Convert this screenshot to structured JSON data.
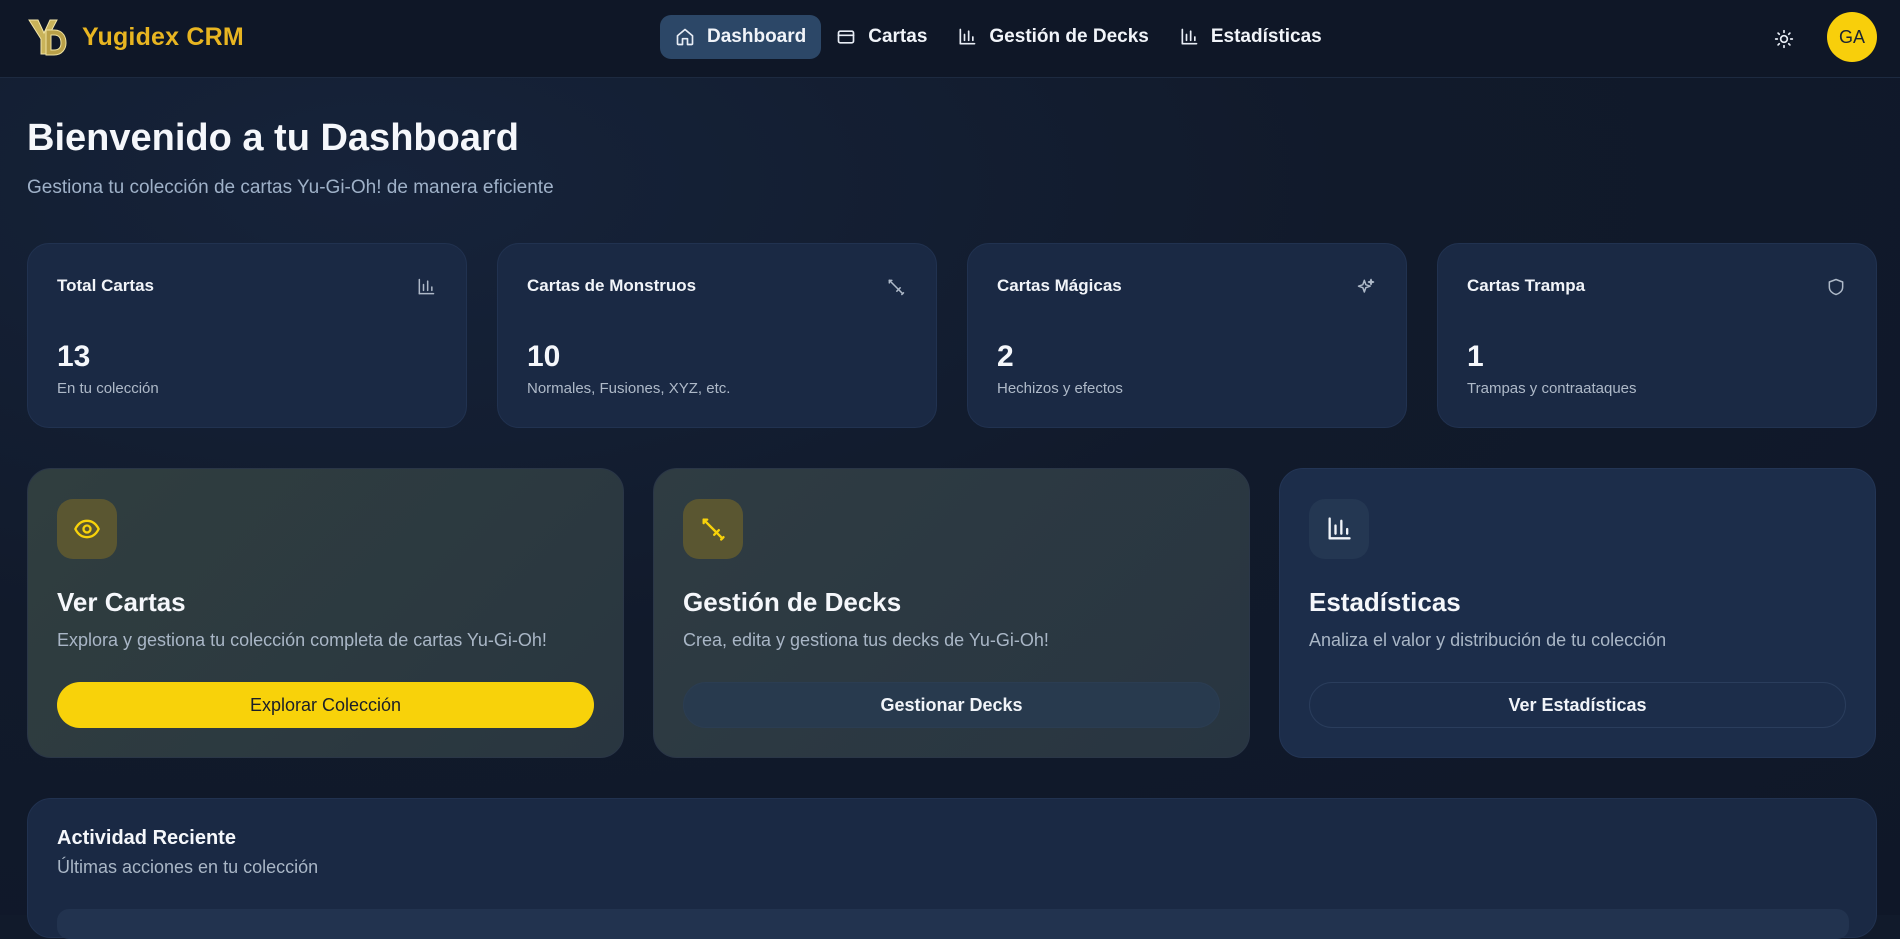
{
  "header": {
    "logo_text": "Yugidex CRM",
    "nav": [
      {
        "label": "Dashboard",
        "icon": "home-icon",
        "active": true
      },
      {
        "label": "Cartas",
        "icon": "card-icon",
        "active": false
      },
      {
        "label": "Gestión de Decks",
        "icon": "bar-chart-icon",
        "active": false
      },
      {
        "label": "Estadísticas",
        "icon": "bar-chart-icon",
        "active": false
      }
    ],
    "theme_icon": "sun-icon",
    "avatar_initials": "GA"
  },
  "page": {
    "title": "Bienvenido a tu Dashboard",
    "subtitle": "Gestiona tu colección de cartas Yu-Gi-Oh! de manera eficiente"
  },
  "stats": [
    {
      "label": "Total Cartas",
      "value": "13",
      "desc": "En tu colección",
      "icon": "bar-chart-icon"
    },
    {
      "label": "Cartas de Monstruos",
      "value": "10",
      "desc": "Normales, Fusiones, XYZ, etc.",
      "icon": "sword-icon"
    },
    {
      "label": "Cartas Mágicas",
      "value": "2",
      "desc": "Hechizos y efectos",
      "icon": "sparkles-icon"
    },
    {
      "label": "Cartas Trampa",
      "value": "1",
      "desc": "Trampas y contraataques",
      "icon": "shield-icon"
    }
  ],
  "cards": [
    {
      "title": "Ver Cartas",
      "text": "Explora y gestiona tu colección completa de cartas Yu-Gi-Oh!",
      "button": "Explorar Colección",
      "icon": "eye-icon"
    },
    {
      "title": "Gestión de Decks",
      "text": "Crea, edita y gestiona tus decks de Yu-Gi-Oh!",
      "button": "Gestionar Decks",
      "icon": "sword-icon"
    },
    {
      "title": "Estadísticas",
      "text": "Analiza el valor y distribución de tu colección",
      "button": "Ver Estadísticas",
      "icon": "bar-chart-icon"
    }
  ],
  "activity": {
    "title": "Actividad Reciente",
    "subtitle": "Últimas acciones en tu colección"
  },
  "colors": {
    "accent": "#f8d20a",
    "brand": "#e8b521",
    "active_nav": "#2c4767"
  }
}
